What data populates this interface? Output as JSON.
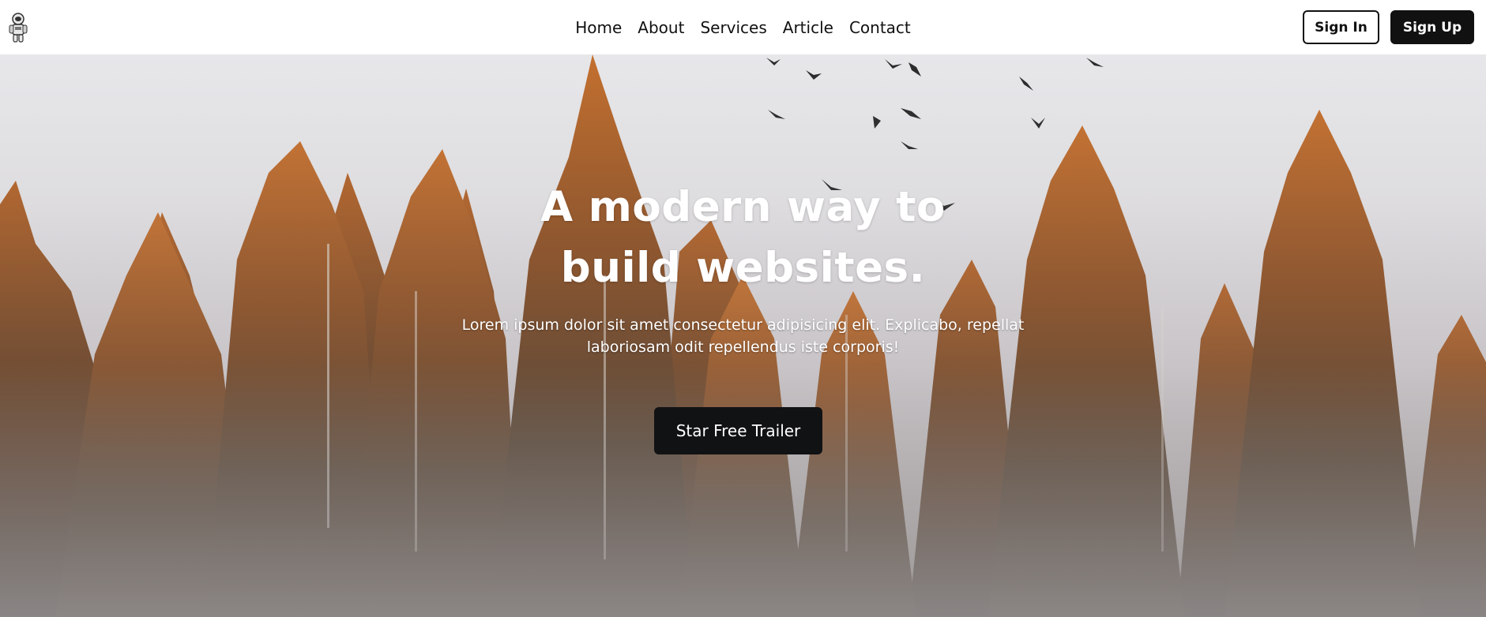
{
  "header": {
    "logo_icon": "astronaut-icon",
    "nav": [
      {
        "label": "Home"
      },
      {
        "label": "About"
      },
      {
        "label": "Services"
      },
      {
        "label": "Article"
      },
      {
        "label": "Contact"
      }
    ],
    "signin_label": "Sign In",
    "signup_label": "Sign Up"
  },
  "hero": {
    "title_line1": "A modern way to",
    "title_line2": "build websites.",
    "subtitle": "Lorem ipsum dolor sit amet consectetur adipisicing elit. Explicabo, repellat laboriosam odit repellendus iste corporis!",
    "cta_label": "Star Free Trailer",
    "background_image": "foggy-pine-forest-with-birds"
  },
  "colors": {
    "primary_dark": "#111111",
    "white": "#ffffff",
    "tree_orange": "#b8652a",
    "tree_dark": "#3a2c1e"
  }
}
